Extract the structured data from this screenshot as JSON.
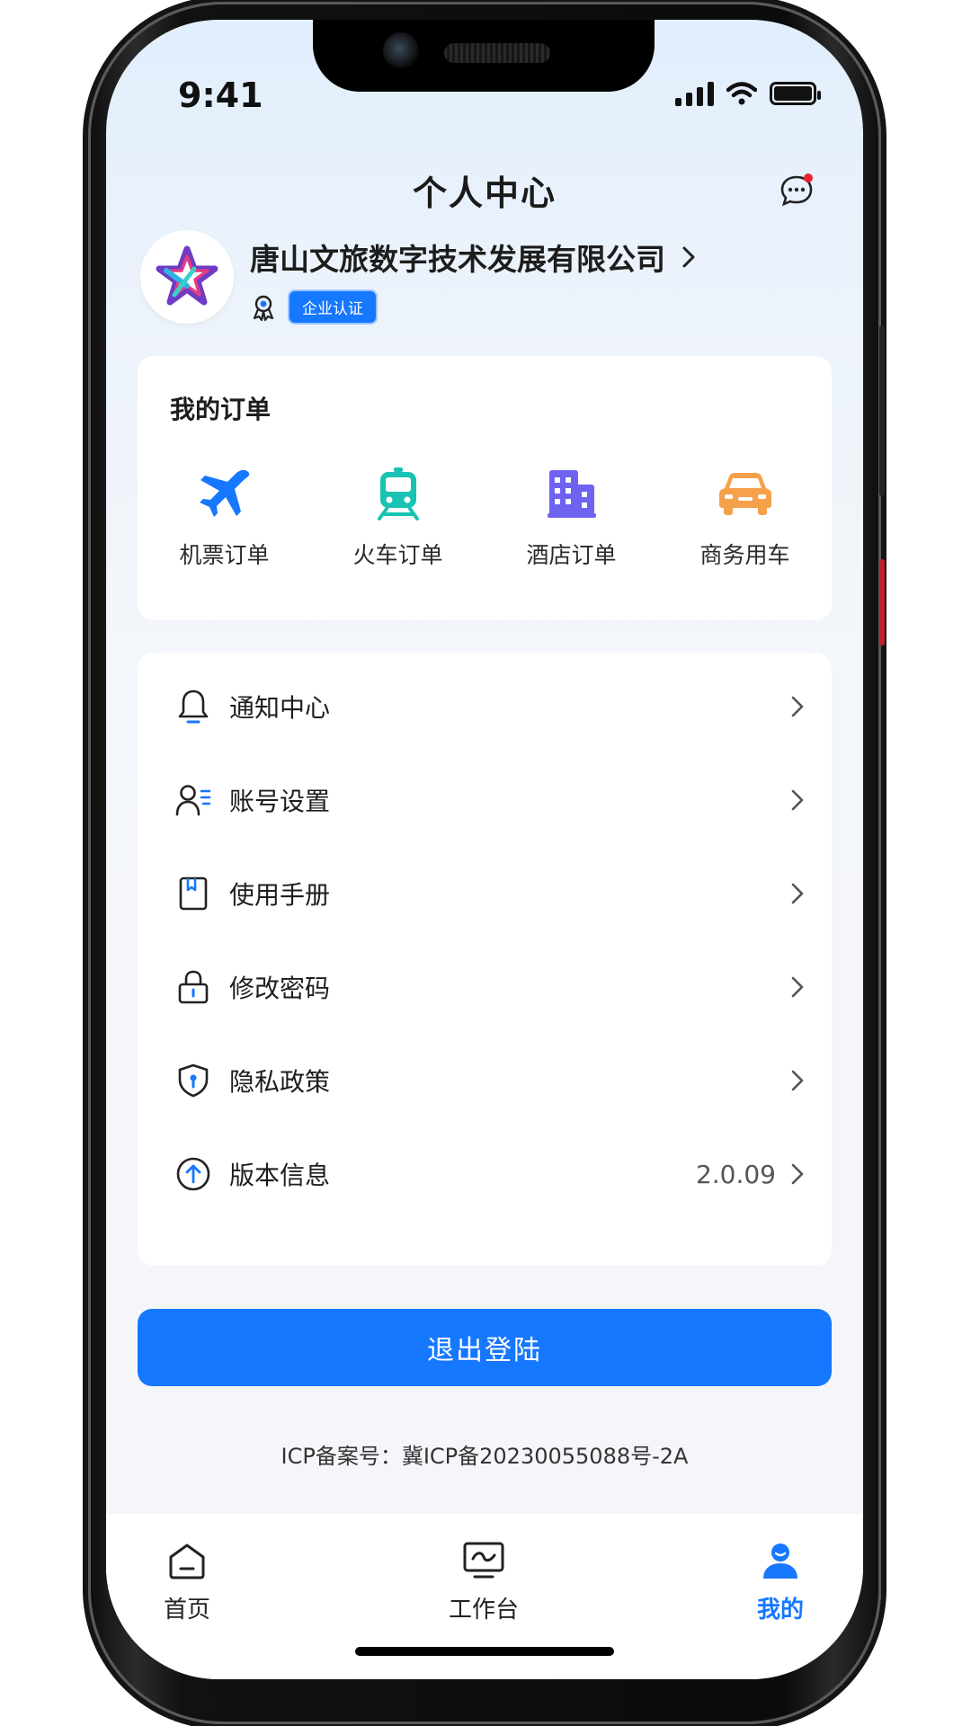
{
  "status": {
    "time": "9:41"
  },
  "header": {
    "title": "个人中心",
    "message_icon": "chat-bubble-icon"
  },
  "profile": {
    "company_name": "唐山文旅数字技术发展有限公司",
    "cert_badge": "企业认证",
    "avatar_icon": "company-logo-icon"
  },
  "orders": {
    "title": "我的订单",
    "items": [
      {
        "label": "机票订单",
        "icon": "airplane-icon",
        "color": "#1677ff"
      },
      {
        "label": "火车订单",
        "icon": "train-icon",
        "color": "#19c3b3"
      },
      {
        "label": "酒店订单",
        "icon": "hotel-icon",
        "color": "#6e63f0"
      },
      {
        "label": "商务用车",
        "icon": "car-icon",
        "color": "#f5a04a"
      }
    ]
  },
  "menu": {
    "items": [
      {
        "label": "通知中心",
        "icon": "bell-icon"
      },
      {
        "label": "账号设置",
        "icon": "user-settings-icon"
      },
      {
        "label": "使用手册",
        "icon": "manual-book-icon"
      },
      {
        "label": "修改密码",
        "icon": "lock-icon"
      },
      {
        "label": "隐私政策",
        "icon": "shield-icon"
      },
      {
        "label": "版本信息",
        "icon": "upload-circle-icon",
        "value": "2.0.09"
      }
    ]
  },
  "logout_label": "退出登陆",
  "icp_text": "ICP备案号：冀ICP备20230055088号-2A",
  "tabs": [
    {
      "label": "首页",
      "icon": "home-icon"
    },
    {
      "label": "工作台",
      "icon": "workbench-icon"
    },
    {
      "label": "我的",
      "icon": "profile-icon",
      "active": true
    }
  ],
  "colors": {
    "primary": "#1677ff",
    "notification_dot": "#e8232b"
  }
}
